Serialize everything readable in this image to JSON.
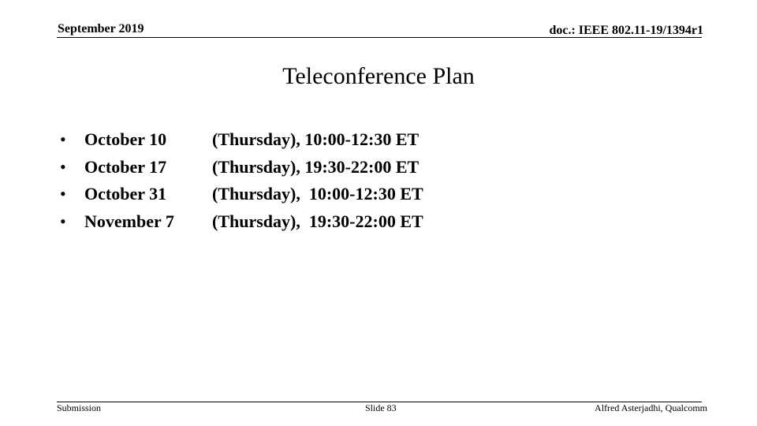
{
  "header": {
    "date": "September 2019",
    "doc_id": "doc.: IEEE 802.11-19/1394r1"
  },
  "title": "Teleconference Plan",
  "items": [
    {
      "bullet": "•",
      "date": "October 10",
      "detail": "(Thursday), 10:00-12:30 ET"
    },
    {
      "bullet": "•",
      "date": "October 17",
      "detail": "(Thursday), 19:30-22:00 ET"
    },
    {
      "bullet": "•",
      "date": "October 31",
      "detail": "(Thursday),  10:00-12:30 ET"
    },
    {
      "bullet": "•",
      "date": "November 7",
      "detail": "(Thursday),  19:30-22:00 ET"
    }
  ],
  "footer": {
    "left": "Submission",
    "center": "Slide 83",
    "right": "Alfred Asterjadhi, Qualcomm"
  }
}
